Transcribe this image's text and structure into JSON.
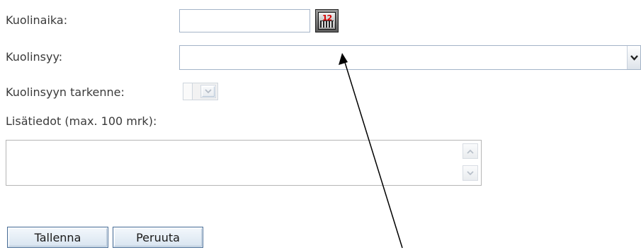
{
  "form": {
    "death_time": {
      "label": "Kuolinaika:",
      "value": "",
      "calendar_digits": "12"
    },
    "death_cause": {
      "label": "Kuolinsyy:",
      "selected": ""
    },
    "death_cause_detail": {
      "label": "Kuolinsyyn tarkenne:",
      "selected": ""
    },
    "additional_info": {
      "label": "Lisätiedot (max. 100 mrk):",
      "value": ""
    }
  },
  "actions": {
    "save_label": "Tallenna",
    "cancel_label": "Peruuta"
  },
  "annotation": {
    "type": "arrow",
    "target": "calendar-button",
    "color": "#000000"
  }
}
